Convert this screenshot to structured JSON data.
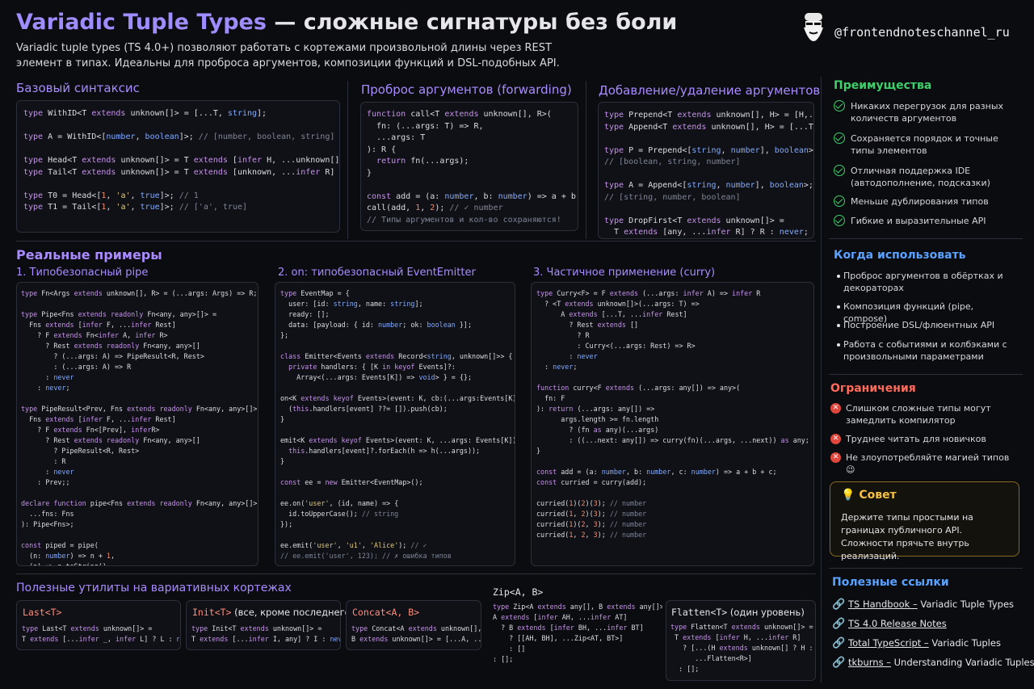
{
  "header": {
    "title_accent": "Variadic Tuple Types",
    "title_rest": " — сложные сигнатуры без боли",
    "intro": "Variadic tuple types (TS 4.0+) позволяют работать с кортежами произвольной длины через REST элемент в типах. Идеальны для проброса аргументов, композиции функций и DSL-подобных API.",
    "handle": "@frontendnoteschannel_ru"
  },
  "sections": {
    "basic": "Базовый синтаксис",
    "forwarding": "Проброс аргументов (forwarding)",
    "addremove": "Добавление/удаление аргументов",
    "real": "Реальные примеры",
    "ex1": "1. Типобезопасный pipe",
    "ex2": "2.  on: типобезопасный EventEmitter",
    "ex3": "3.  Частичное применение (curry)",
    "utils": "Полезные утилиты на вариативных кортежах"
  },
  "advantages": {
    "title": "Преимущества",
    "items": [
      "Никаких перегрузок для разных количеств аргументов",
      "Сохраняется порядок и точные типы элементов",
      "Отличная поддержка IDE (автодополнение, подсказки)",
      "Меньше дублирования типов",
      "Гибкие и выразительные API"
    ]
  },
  "when": {
    "title": "Когда использовать",
    "items": [
      "Проброс аргументов в обёртках и декораторах",
      "Композиция функций (pipe, compose)",
      "Построение DSL/флюентных API",
      "Работа с событиями и колбэками с произвольными параметрами"
    ]
  },
  "limits": {
    "title": "Ограничения",
    "items": [
      "Слишком сложные типы могут замедлить компилятор",
      "Труднее читать для новичков",
      "Не злоупотребляйте магией типов 😉"
    ]
  },
  "tip": {
    "title": "Совет",
    "text": "Держите типы простыми на границах публичного API. Сложности прячьте внутрь реализаций."
  },
  "links": {
    "title": "Полезные ссылки",
    "items": [
      {
        "label": "TS Handbook –",
        "rest": " Variadic Tuple Types"
      },
      {
        "label": "TS 4.0 Release Notes",
        "rest": ""
      },
      {
        "label": "Total TypeScript –",
        "rest": " Variadic Tuples"
      },
      {
        "label": "tkburns –",
        "rest": " Understanding Variadic Tuples"
      }
    ]
  },
  "utils": [
    {
      "name": "Last<T>",
      "rest": ""
    },
    {
      "name": "Init<T>",
      "rest": " (все, кроме последнего)"
    },
    {
      "name": "Concat<A, B>",
      "rest": ""
    },
    {
      "name": "Zip<A, B>",
      "rest": ""
    },
    {
      "name": "Flatten<T>",
      "rest": " (один уровень)"
    }
  ],
  "colors": {
    "accent": "#9f8cff",
    "green": "#3ecf6a",
    "blue": "#5aa2ff",
    "red": "#ff6b5a",
    "gold": "#f5c044"
  }
}
